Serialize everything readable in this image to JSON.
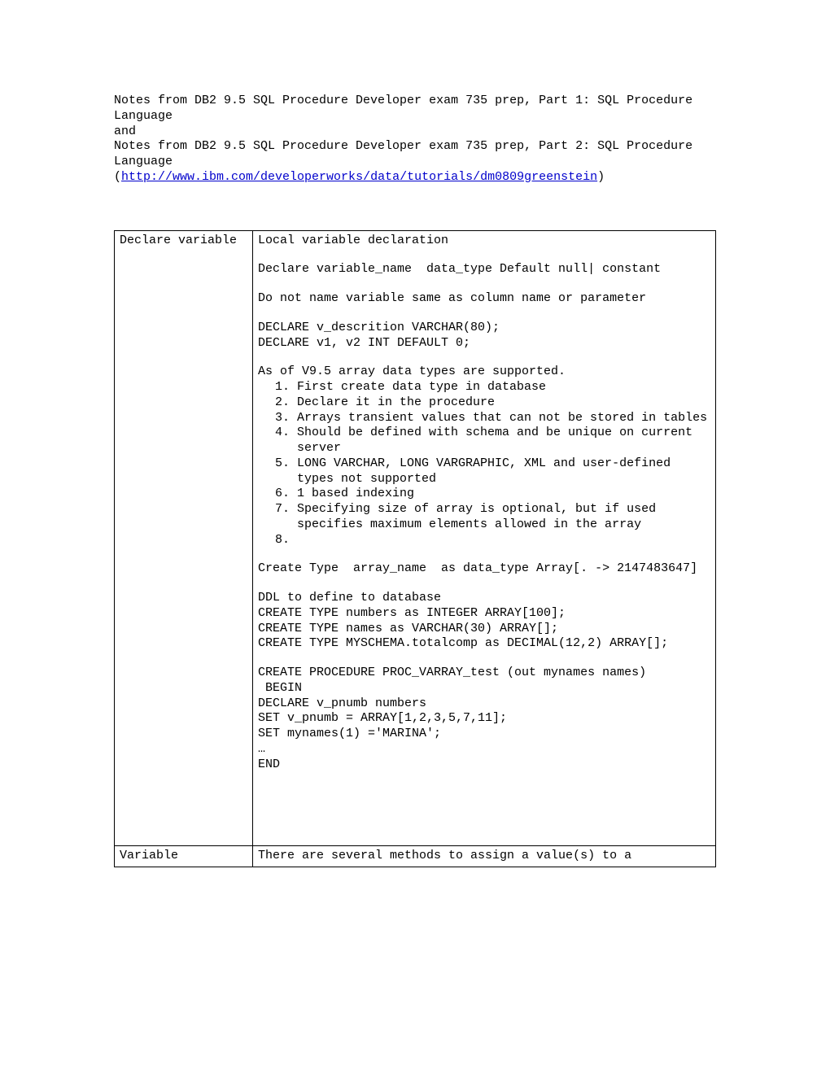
{
  "intro": {
    "line1": "Notes from DB2 9.5 SQL Procedure Developer exam 735 prep, Part 1: SQL Procedure Language",
    "and": "and",
    "line2": "Notes from DB2 9.5 SQL Procedure Developer exam 735 prep, Part 2: SQL Procedure Language",
    "url": "http://www.ibm.com/developerworks/data/tutorials/dm0809greenstein"
  },
  "row1": {
    "left": "Declare variable",
    "p1": "Local variable declaration",
    "p2": "Declare variable_name  data_type Default null| constant",
    "p3": "Do not name variable same as column name or parameter",
    "p4": "DECLARE v_descrition VARCHAR(80);\nDECLARE v1, v2 INT DEFAULT 0;",
    "p5_lead": "As of V9.5 array data types are supported.",
    "list": [
      "First create data type in database",
      "Declare it in the procedure",
      "Arrays transient values that can not be stored in tables",
      "Should be defined with schema and be unique on current server",
      "LONG VARCHAR, LONG VARGRAPHIC, XML and user-defined types not supported",
      "1 based indexing",
      "Specifying size of array is optional, but if used specifies maximum elements allowed in the array",
      ""
    ],
    "p6": "Create Type  array_name  as data_type Array[. -> 2147483647]",
    "p7": "DDL to define to database\nCREATE TYPE numbers as INTEGER ARRAY[100];\nCREATE TYPE names as VARCHAR(30) ARRAY[];\nCREATE TYPE MYSCHEMA.totalcomp as DECIMAL(12,2) ARRAY[];",
    "p8": "CREATE PROCEDURE PROC_VARRAY_test (out mynames names)\n BEGIN\nDECLARE v_pnumb numbers\nSET v_pnumb = ARRAY[1,2,3,5,7,11];\nSET mynames(1) ='MARINA';\n…\nEND"
  },
  "row2": {
    "left": "Variable",
    "right": "There are several methods to assign a value(s) to a"
  }
}
